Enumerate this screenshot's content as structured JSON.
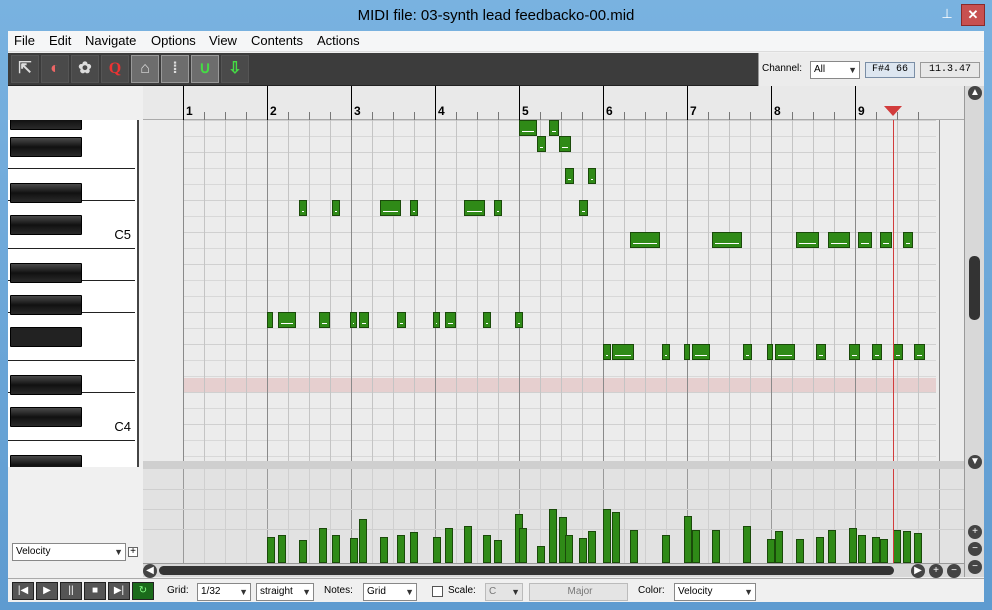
{
  "window": {
    "title": "MIDI file: 03-synth lead feedbacko-00.mid",
    "pin_glyph": "⊥",
    "close_glyph": "✕"
  },
  "menu": [
    "File",
    "Edit",
    "Navigate",
    "Options",
    "View",
    "Contents",
    "Actions"
  ],
  "toolbar": {
    "buttons": [
      {
        "name": "piano-roll-icon",
        "glyph": "⇱"
      },
      {
        "name": "drum-icon",
        "glyph": "◐"
      },
      {
        "name": "palette-icon",
        "glyph": "✿"
      },
      {
        "name": "quantize-icon",
        "glyph": "Q"
      },
      {
        "name": "event-list-icon",
        "glyph": "⌂"
      },
      {
        "name": "grid-dots-icon",
        "glyph": "⁞"
      },
      {
        "name": "magnet-snap-icon",
        "glyph": "∪"
      },
      {
        "name": "velocity-icon",
        "glyph": "⇩"
      }
    ],
    "channel_label": "Channel:",
    "channel_value": "All",
    "pitch_readout": "F#4  66",
    "position_readout": "11.3.47"
  },
  "ruler": {
    "measures": [
      "1",
      "2",
      "3",
      "4",
      "5",
      "6",
      "7",
      "8",
      "9"
    ]
  },
  "keys": {
    "labels": [
      {
        "text": "C5"
      },
      {
        "text": "C4"
      }
    ]
  },
  "notes": [
    {
      "m": 5.0,
      "len": 0.22,
      "row": 0
    },
    {
      "m": 5.36,
      "len": 0.12,
      "row": 0
    },
    {
      "m": 5.22,
      "len": 0.1,
      "row": 1
    },
    {
      "m": 5.48,
      "len": 0.14,
      "row": 1
    },
    {
      "m": 5.55,
      "len": 0.1,
      "row": 3
    },
    {
      "m": 5.82,
      "len": 0.1,
      "row": 3
    },
    {
      "m": 2.38,
      "len": 0.1,
      "row": 5
    },
    {
      "m": 2.77,
      "len": 0.1,
      "row": 5
    },
    {
      "m": 3.35,
      "len": 0.24,
      "row": 5
    },
    {
      "m": 3.7,
      "len": 0.1,
      "row": 5
    },
    {
      "m": 4.35,
      "len": 0.24,
      "row": 5
    },
    {
      "m": 4.7,
      "len": 0.1,
      "row": 5
    },
    {
      "m": 5.72,
      "len": 0.1,
      "row": 5
    },
    {
      "m": 6.32,
      "len": 0.36,
      "row": 7
    },
    {
      "m": 7.3,
      "len": 0.35,
      "row": 7
    },
    {
      "m": 8.3,
      "len": 0.27,
      "row": 7
    },
    {
      "m": 8.68,
      "len": 0.26,
      "row": 7
    },
    {
      "m": 9.03,
      "len": 0.17,
      "row": 7
    },
    {
      "m": 9.3,
      "len": 0.14,
      "row": 7
    },
    {
      "m": 9.57,
      "len": 0.12,
      "row": 7
    },
    {
      "m": 2.0,
      "len": 0.06,
      "row": 12
    },
    {
      "m": 2.13,
      "len": 0.22,
      "row": 12
    },
    {
      "m": 2.62,
      "len": 0.13,
      "row": 12
    },
    {
      "m": 2.99,
      "len": 0.08,
      "row": 12
    },
    {
      "m": 3.1,
      "len": 0.12,
      "row": 12
    },
    {
      "m": 3.55,
      "len": 0.1,
      "row": 12
    },
    {
      "m": 3.98,
      "len": 0.08,
      "row": 12
    },
    {
      "m": 4.12,
      "len": 0.13,
      "row": 12
    },
    {
      "m": 4.57,
      "len": 0.1,
      "row": 12
    },
    {
      "m": 4.95,
      "len": 0.1,
      "row": 12
    },
    {
      "m": 6.0,
      "len": 0.1,
      "row": 14
    },
    {
      "m": 6.11,
      "len": 0.26,
      "row": 14
    },
    {
      "m": 6.7,
      "len": 0.1,
      "row": 14
    },
    {
      "m": 6.96,
      "len": 0.07,
      "row": 14
    },
    {
      "m": 7.06,
      "len": 0.21,
      "row": 14
    },
    {
      "m": 7.67,
      "len": 0.1,
      "row": 14
    },
    {
      "m": 7.95,
      "len": 0.07,
      "row": 14
    },
    {
      "m": 8.05,
      "len": 0.23,
      "row": 14
    },
    {
      "m": 8.54,
      "len": 0.12,
      "row": 14
    },
    {
      "m": 8.93,
      "len": 0.13,
      "row": 14
    },
    {
      "m": 9.2,
      "len": 0.12,
      "row": 14
    },
    {
      "m": 9.45,
      "len": 0.12,
      "row": 14
    },
    {
      "m": 9.7,
      "len": 0.13,
      "row": 14
    }
  ],
  "velocity": [
    {
      "m": 2.0,
      "v": 0.28
    },
    {
      "m": 2.13,
      "v": 0.3
    },
    {
      "m": 2.38,
      "v": 0.24
    },
    {
      "m": 2.62,
      "v": 0.37
    },
    {
      "m": 2.77,
      "v": 0.3
    },
    {
      "m": 2.99,
      "v": 0.27
    },
    {
      "m": 3.1,
      "v": 0.47
    },
    {
      "m": 3.35,
      "v": 0.28
    },
    {
      "m": 3.55,
      "v": 0.3
    },
    {
      "m": 3.7,
      "v": 0.33
    },
    {
      "m": 3.98,
      "v": 0.28
    },
    {
      "m": 4.12,
      "v": 0.37
    },
    {
      "m": 4.35,
      "v": 0.39
    },
    {
      "m": 4.57,
      "v": 0.3
    },
    {
      "m": 4.7,
      "v": 0.24
    },
    {
      "m": 4.95,
      "v": 0.52
    },
    {
      "m": 5.0,
      "v": 0.37
    },
    {
      "m": 5.22,
      "v": 0.18
    },
    {
      "m": 5.36,
      "v": 0.57
    },
    {
      "m": 5.48,
      "v": 0.49
    },
    {
      "m": 5.55,
      "v": 0.3
    },
    {
      "m": 5.72,
      "v": 0.27
    },
    {
      "m": 5.82,
      "v": 0.34
    },
    {
      "m": 6.0,
      "v": 0.57
    },
    {
      "m": 6.11,
      "v": 0.54
    },
    {
      "m": 6.32,
      "v": 0.35
    },
    {
      "m": 6.7,
      "v": 0.3
    },
    {
      "m": 6.96,
      "v": 0.5
    },
    {
      "m": 7.06,
      "v": 0.35
    },
    {
      "m": 7.3,
      "v": 0.35
    },
    {
      "m": 7.67,
      "v": 0.39
    },
    {
      "m": 7.95,
      "v": 0.26
    },
    {
      "m": 8.05,
      "v": 0.34
    },
    {
      "m": 8.3,
      "v": 0.26
    },
    {
      "m": 8.54,
      "v": 0.28
    },
    {
      "m": 8.68,
      "v": 0.35
    },
    {
      "m": 8.93,
      "v": 0.37
    },
    {
      "m": 9.03,
      "v": 0.3
    },
    {
      "m": 9.2,
      "v": 0.28
    },
    {
      "m": 9.3,
      "v": 0.26
    },
    {
      "m": 9.45,
      "v": 0.35
    },
    {
      "m": 9.57,
      "v": 0.34
    },
    {
      "m": 9.7,
      "v": 0.32
    }
  ],
  "playhead_measure": 9.45,
  "cc_lane": {
    "selector": "Velocity",
    "add_glyph": "+"
  },
  "status": {
    "transport": [
      {
        "name": "rewind-button",
        "glyph": "|◀"
      },
      {
        "name": "play-button",
        "glyph": "▶"
      },
      {
        "name": "pause-button",
        "glyph": "||"
      },
      {
        "name": "stop-button",
        "glyph": "■"
      },
      {
        "name": "forward-button",
        "glyph": "▶|"
      },
      {
        "name": "loop-button",
        "glyph": "↻"
      }
    ],
    "grid_label": "Grid:",
    "grid_value": "1/32",
    "grid_type": "straight",
    "notes_label": "Notes:",
    "notes_value": "Grid",
    "scale_label": "Scale:",
    "scale_key": "C",
    "scale_name": "Major",
    "color_label": "Color:",
    "color_value": "Velocity"
  },
  "colors": {
    "note": "#2f8a17",
    "playhead": "#d23c3c",
    "highlight_row": "#e6cfcf"
  }
}
